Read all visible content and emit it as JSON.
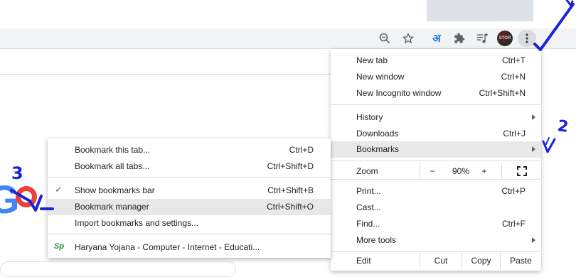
{
  "toolbar": {
    "icons": [
      "zoom-out-icon",
      "star-icon",
      "hindi-input-icon",
      "extensions-icon",
      "media-control-icon",
      "profile-avatar",
      "more-menu-icon"
    ],
    "hindi_glyph": "अ",
    "avatar_text": "STOR"
  },
  "menu": {
    "new_tab": {
      "label": "New tab",
      "shortcut": "Ctrl+T"
    },
    "new_window": {
      "label": "New window",
      "shortcut": "Ctrl+N"
    },
    "new_incognito": {
      "label": "New Incognito window",
      "shortcut": "Ctrl+Shift+N"
    },
    "history": {
      "label": "History"
    },
    "downloads": {
      "label": "Downloads",
      "shortcut": "Ctrl+J"
    },
    "bookmarks": {
      "label": "Bookmarks"
    },
    "zoom": {
      "label": "Zoom",
      "minus": "−",
      "value": "90%",
      "plus": "+"
    },
    "print": {
      "label": "Print...",
      "shortcut": "Ctrl+P"
    },
    "cast": {
      "label": "Cast..."
    },
    "find": {
      "label": "Find...",
      "shortcut": "Ctrl+F"
    },
    "more_tools": {
      "label": "More tools"
    },
    "edit": {
      "label": "Edit",
      "cut": "Cut",
      "copy": "Copy",
      "paste": "Paste"
    }
  },
  "bookmarks_submenu": {
    "bookmark_tab": {
      "label": "Bookmark this tab...",
      "shortcut": "Ctrl+D"
    },
    "bookmark_all": {
      "label": "Bookmark all tabs...",
      "shortcut": "Ctrl+Shift+D"
    },
    "show_bar": {
      "label": "Show bookmarks bar",
      "shortcut": "Ctrl+Shift+B",
      "checked": true
    },
    "manager": {
      "label": "Bookmark manager",
      "shortcut": "Ctrl+Shift+O"
    },
    "import": {
      "label": "Import bookmarks and settings..."
    },
    "saved": {
      "favicon": "Sp",
      "label": "Haryana Yojana - Computer - Internet - Educati..."
    }
  },
  "annotations": {
    "step1": "1",
    "step2": "2",
    "step3": "3"
  },
  "colors": {
    "annotation": "#1a23d6",
    "highlight": "#e8e8e8",
    "toolbar": "#f1f3f4"
  }
}
